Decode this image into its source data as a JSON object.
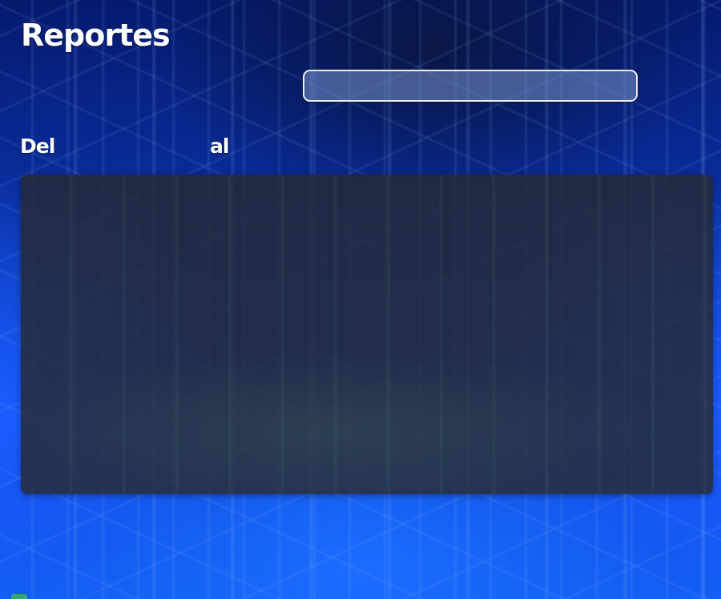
{
  "page": {
    "title": "Reportes"
  },
  "filters": {
    "search_value": "",
    "from_label": "Del",
    "to_label": "al"
  },
  "colors": {
    "text": "#ffffff",
    "panel": "#262a34",
    "input_border": "#e8eef8"
  }
}
